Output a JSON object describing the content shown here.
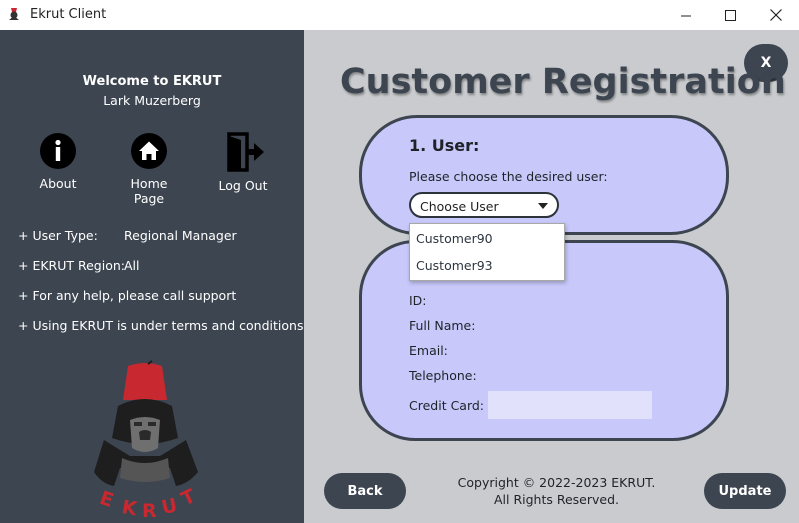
{
  "window": {
    "title": "Ekrut Client",
    "controls": {
      "minimize": "—",
      "maximize": "☐",
      "close": "✕"
    }
  },
  "sidebar": {
    "welcome": "Welcome to EKRUT",
    "user_name": "Lark Muzerberg",
    "nav": [
      {
        "label": "About",
        "icon": "info-icon"
      },
      {
        "label": "Home Page",
        "icon": "home-icon"
      },
      {
        "label": "Log Out",
        "icon": "logout-icon"
      }
    ],
    "info": {
      "user_type_label": "+ User Type:",
      "user_type_value": "Regional Manager",
      "region_label": "+ EKRUT Region:",
      "region_value": "All",
      "help": "+ For any help, please call support",
      "terms": "+ Using EKRUT is under terms and conditions"
    },
    "logo": {
      "name": "ekrut-gorilla-logo",
      "text": "EKRUT",
      "accent": "#c8282f"
    }
  },
  "main": {
    "close_label": "X",
    "title": "Customer Registration",
    "user_section": {
      "title": "1. User:",
      "prompt": "Please choose the desired user:",
      "select_value": "Choose User",
      "options": [
        "Customer90",
        "Customer93"
      ]
    },
    "details_section": {
      "id_label": "ID:",
      "full_name_label": "Full Name:",
      "email_label": "Email:",
      "telephone_label": "Telephone:",
      "credit_card_label": "Credit Card:",
      "credit_card_value": ""
    },
    "back_label": "Back",
    "update_label": "Update",
    "copyright_line1": "Copyright © 2022-2023 EKRUT.",
    "copyright_line2": "All Rights Reserved."
  },
  "colors": {
    "sidebar_bg": "#3d4550",
    "main_bg": "#c9cbce",
    "card_bg": "#c8c8fb",
    "accent_red": "#c8282f"
  }
}
